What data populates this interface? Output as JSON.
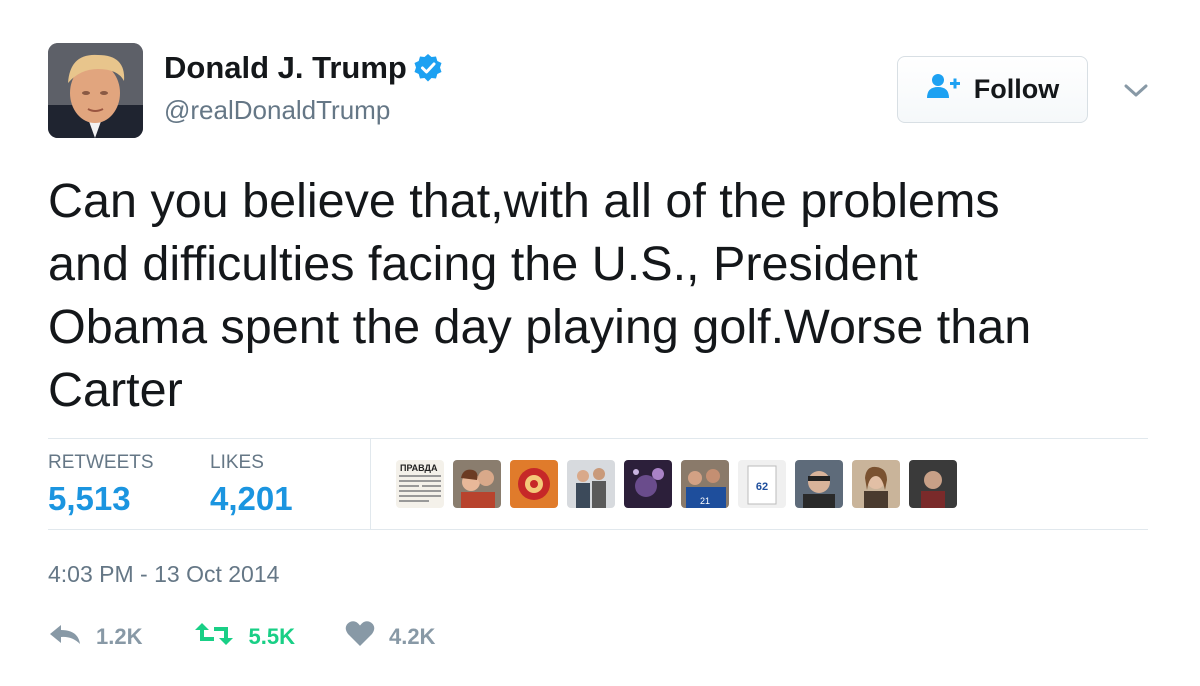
{
  "colors": {
    "link_blue": "#1b95e0",
    "secondary_text": "#657786",
    "retweet_green": "#19cf86",
    "icon_gray": "#8899a6"
  },
  "author": {
    "name": "Donald J. Trump",
    "handle": "@realDonaldTrump",
    "verified_icon": "verified-badge-icon",
    "avatar": "profile-photo"
  },
  "follow_button": {
    "label": "Follow",
    "icon": "add-user-icon"
  },
  "menu": {
    "icon": "chevron-down-icon"
  },
  "tweet": {
    "text": "Can you believe that,with all of the problems\nand difficulties facing the U.S., President\nObama spent the day playing golf.Worse than\nCarter"
  },
  "stats": {
    "retweets_label": "RETWEETS",
    "retweets_value": "5,513",
    "likes_label": "LIKES",
    "likes_value": "4,201"
  },
  "likers": [
    {
      "kind": "newspaper-thumbnail",
      "text": "ПРАВДА"
    },
    {
      "kind": "user-avatar"
    },
    {
      "kind": "user-avatar"
    },
    {
      "kind": "user-avatar"
    },
    {
      "kind": "user-avatar"
    },
    {
      "kind": "user-avatar"
    },
    {
      "kind": "user-avatar"
    },
    {
      "kind": "user-avatar"
    },
    {
      "kind": "user-avatar"
    },
    {
      "kind": "user-avatar"
    }
  ],
  "timestamp": "4:03 PM - 13 Oct 2014",
  "actions": {
    "reply_icon": "reply-icon",
    "reply_count": "1.2K",
    "retweet_icon": "retweet-icon",
    "retweet_count": "5.5K",
    "like_icon": "heart-icon",
    "like_count": "4.2K"
  }
}
